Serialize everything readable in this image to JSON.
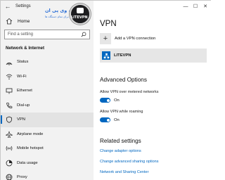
{
  "window": {
    "title": "Settings"
  },
  "controls": {
    "minimize": "—",
    "maximize": "☐",
    "close": "✕"
  },
  "sidebar": {
    "home": "Home",
    "search_placeholder": "Find a setting",
    "section": "Network & Internet",
    "items": [
      {
        "label": "Status",
        "icon": "status-icon"
      },
      {
        "label": "Wi-Fi",
        "icon": "wifi-icon"
      },
      {
        "label": "Ethernet",
        "icon": "ethernet-icon"
      },
      {
        "label": "Dial-up",
        "icon": "dialup-icon"
      },
      {
        "label": "VPN",
        "icon": "vpn-icon",
        "selected": true
      },
      {
        "label": "Airplane mode",
        "icon": "airplane-icon"
      },
      {
        "label": "Mobile hotspot",
        "icon": "hotspot-icon"
      },
      {
        "label": "Data usage",
        "icon": "data-usage-icon"
      },
      {
        "label": "Proxy",
        "icon": "proxy-icon"
      }
    ]
  },
  "watermark": {
    "line1": "لایت وی پی ان",
    "line2": "فیلترشکن برای تمام دستگاه ها",
    "brand": "LITEVPN"
  },
  "main": {
    "title": "VPN",
    "add_vpn": "Add a VPN connection",
    "vpn_connection": "LITEVPN",
    "advanced_heading": "Advanced Options",
    "opt1_label": "Allow VPN over metered networks",
    "opt1_state": "On",
    "opt2_label": "Allow VPN while roaming",
    "opt2_state": "On",
    "related_heading": "Related settings",
    "link1": "Change adapter options",
    "link2": "Change advanced sharing options",
    "link3": "Network and Sharing Center"
  },
  "colors": {
    "accent": "#0067c0",
    "sidebar_bg": "#f2f2f2"
  }
}
